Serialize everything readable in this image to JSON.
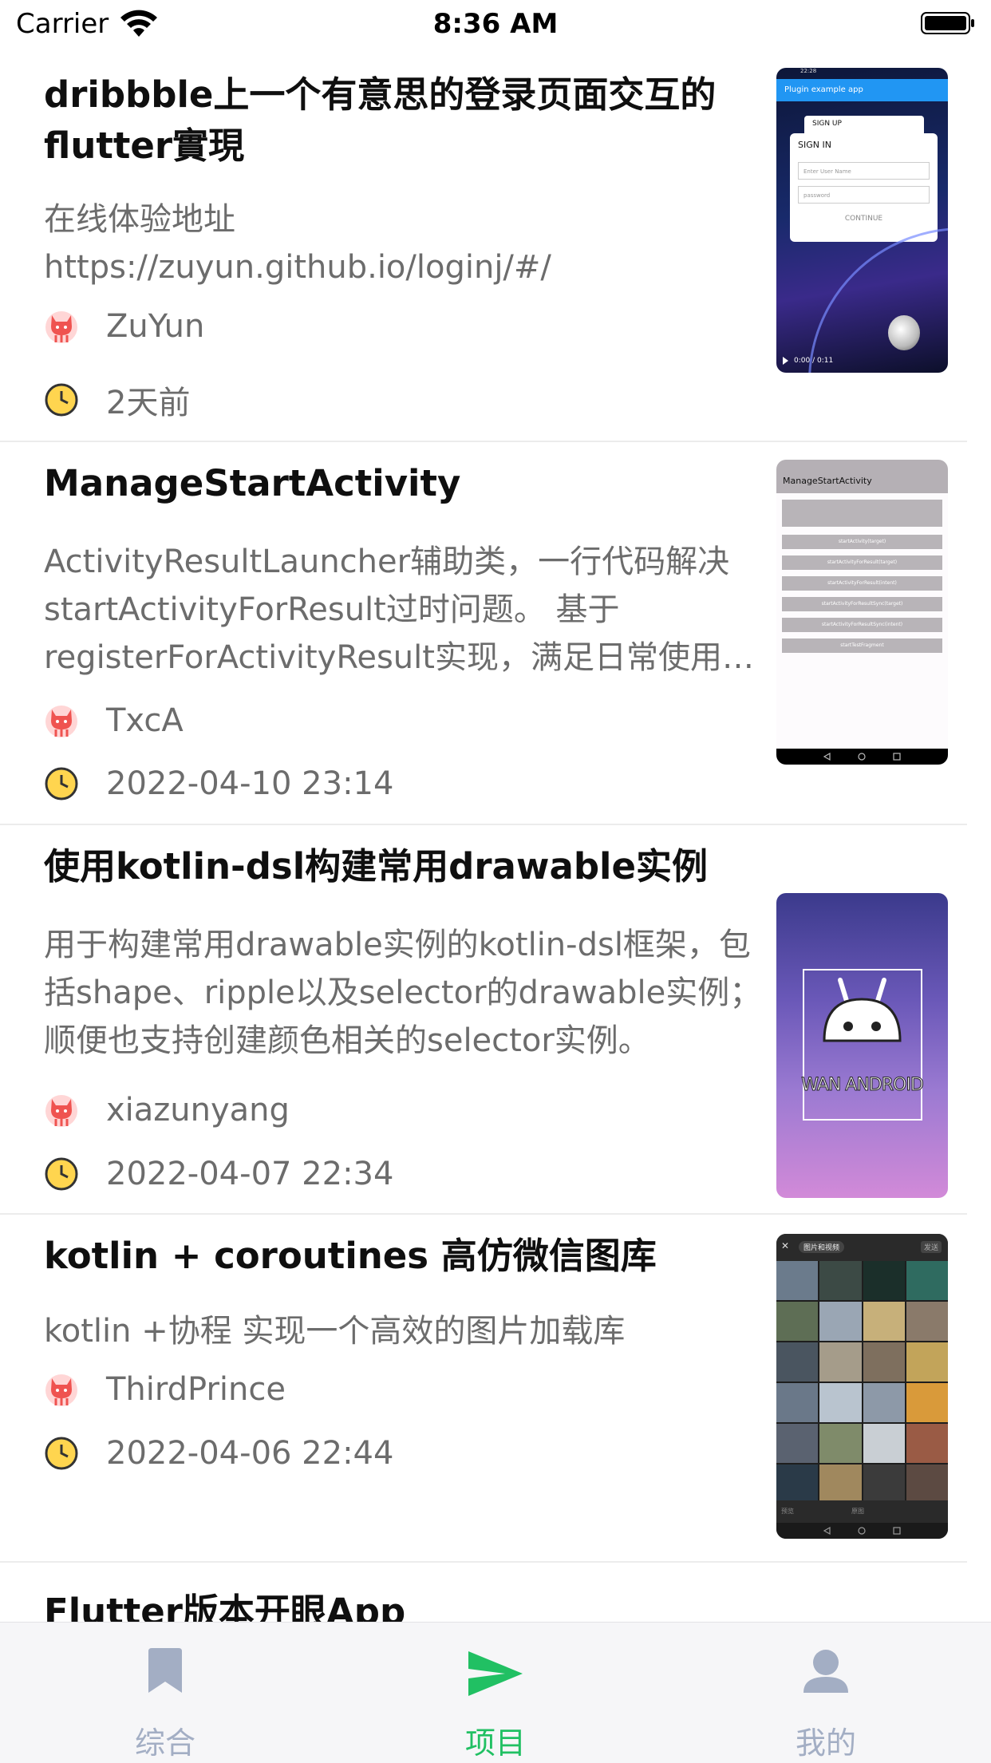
{
  "status_bar": {
    "carrier": "Carrier",
    "time": "8:36 AM"
  },
  "articles": [
    {
      "title": "dribbble上一个有意思的登录页面交互的flutter實現",
      "desc": "在线体验地址\nhttps://zuyun.github.io/loginj/#/",
      "author": "ZuYun",
      "time": "2天前",
      "thumb": {
        "app_title": "Plugin example app",
        "sign_up": "SIGN UP",
        "sign_in": "SIGN IN",
        "user_ph": "Enter User Name",
        "pass_ph": "password",
        "continue": "CONTINUE",
        "video_time": "0:00 / 0:11",
        "status_time": "22:28"
      }
    },
    {
      "title": "ManageStartActivity",
      "desc": "ActivityResultLauncher辅助类，一行代码解决startActivityForResult过时问题。 基于registerForActivityResult实现，满足日常使用场景。",
      "author": "TxcA",
      "time": "2022-04-10 23:14",
      "thumb": {
        "app_title": "ManageStartActivity",
        "buttons": [
          "startActivity(target)",
          "startActivityForResult(target)",
          "startActivityForResult(intent)",
          "startActivityForResultSync(target)",
          "startActivityForResultSync(intent)",
          "startTestFragment"
        ]
      }
    },
    {
      "title": "使用kotlin-dsl构建常用drawable实例",
      "desc": "用于构建常用drawable实例的kotlin-dsl框架，包括shape、ripple以及selector的drawable实例；顺便也支持创建颜色相关的selector实例。",
      "author": "xiazunyang",
      "time": "2022-04-07 22:34",
      "thumb": {
        "logo_text": "WAN ANDROID"
      }
    },
    {
      "title": "kotlin + coroutines 高仿微信图库",
      "desc": "kotlin +协程 实现一个高效的图片加载库",
      "author": "ThirdPrince",
      "time": "2022-04-06 22:44",
      "thumb": {
        "header": "图片和视频",
        "send": "发送",
        "preview": "预览",
        "original": "原图"
      }
    },
    {
      "title": "Flutter版本开眼App"
    }
  ],
  "tabs": [
    {
      "label": "综合",
      "icon": "bookmark-icon",
      "active": false
    },
    {
      "label": "项目",
      "icon": "send-icon",
      "active": true
    },
    {
      "label": "我的",
      "icon": "person-icon",
      "active": false
    }
  ],
  "colors": {
    "accent": "#21c063",
    "inactive": "#a3aec4",
    "title": "#0f0f0f",
    "secondary": "#6c6c6c"
  }
}
